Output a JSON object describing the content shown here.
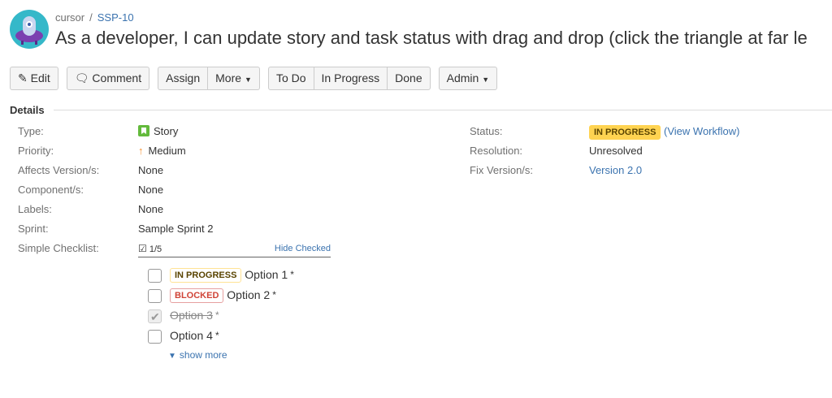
{
  "breadcrumb": {
    "project": "cursor",
    "issue_key": "SSP-10"
  },
  "issue": {
    "title": "As a developer, I can update story and task status with drag and drop (click the triangle at far le"
  },
  "toolbar": {
    "edit": "Edit",
    "comment": "Comment",
    "assign": "Assign",
    "more": "More",
    "todo": "To Do",
    "in_progress": "In Progress",
    "done": "Done",
    "admin": "Admin"
  },
  "details": {
    "heading": "Details",
    "left": [
      {
        "label": "Type:",
        "value": "Story",
        "icon": "story-icon"
      },
      {
        "label": "Priority:",
        "value": "Medium",
        "icon": "arrow-up-icon"
      },
      {
        "label": "Affects Version/s:",
        "value": "None"
      },
      {
        "label": "Component/s:",
        "value": "None"
      },
      {
        "label": "Labels:",
        "value": "None"
      },
      {
        "label": "Sprint:",
        "value": "Sample Sprint 2"
      },
      {
        "label": "Simple Checklist:"
      }
    ],
    "right": [
      {
        "label": "Status:",
        "value": "IN PROGRESS",
        "link": "(View Workflow)"
      },
      {
        "label": "Resolution:",
        "value": "Unresolved"
      },
      {
        "label": "Fix Version/s:",
        "value": "Version 2.0"
      }
    ]
  },
  "checklist": {
    "progress": "1/5",
    "hide_checked": "Hide Checked",
    "items": [
      {
        "badge": "IN PROGRESS",
        "label": "Option 1",
        "checked": false
      },
      {
        "badge": "BLOCKED",
        "label": "Option 2",
        "checked": false
      },
      {
        "label": "Option 3",
        "checked": true
      },
      {
        "label": "Option 4",
        "checked": false
      }
    ],
    "star": "*",
    "show_more": "show more"
  },
  "colors": {
    "link": "#3b73af",
    "status_yellow": "#ffd351",
    "story_green": "#63ba3c",
    "priority_orange": "#f79232",
    "blocked_red": "#d04437"
  }
}
